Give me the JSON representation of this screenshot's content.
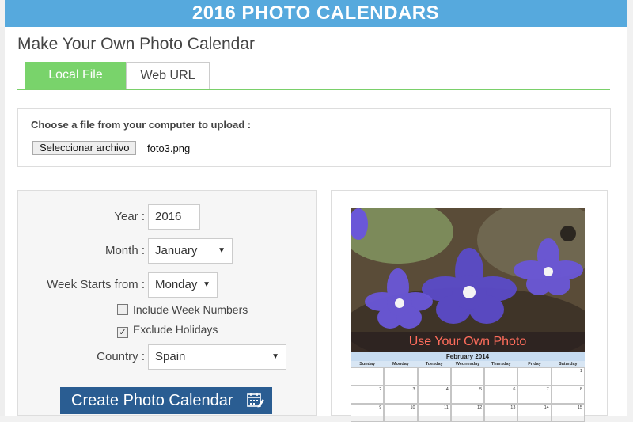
{
  "banner": {
    "title": "2016 PHOTO CALENDARS"
  },
  "page": {
    "heading": "Make Your Own Photo Calendar"
  },
  "tabs": [
    {
      "label": "Local File",
      "active": true
    },
    {
      "label": "Web URL",
      "active": false
    }
  ],
  "upload": {
    "label": "Choose a file from your computer to upload :",
    "button_label": "Seleccionar archivo",
    "file_name": "foto3.png"
  },
  "form": {
    "year_label": "Year :",
    "year_value": "2016",
    "month_label": "Month :",
    "month_value": "January",
    "week_label": "Week Starts from :",
    "week_value": "Monday",
    "week_numbers_label": "Include Week Numbers",
    "week_numbers_checked": false,
    "holidays_label": "Exclude Holidays",
    "holidays_checked": true,
    "country_label": "Country :",
    "country_value": "Spain",
    "submit_label": "Create Photo Calendar"
  },
  "preview": {
    "caption": "Use Your Own Photo",
    "calendar_title": "February 2014",
    "day_names": [
      "Sunday",
      "Monday",
      "Tuesday",
      "Wednesday",
      "Thursday",
      "Friday",
      "Saturday"
    ],
    "cells": [
      "",
      "",
      "",
      "",
      "",
      "",
      "1",
      "2",
      "3",
      "4",
      "5",
      "6",
      "7",
      "8",
      "9",
      "10",
      "11",
      "12",
      "13",
      "14",
      "15"
    ]
  },
  "colors": {
    "banner": "#56a9dd",
    "tab_active": "#79d36b",
    "button": "#2a5d92",
    "caption_text": "#ff6d5c"
  }
}
